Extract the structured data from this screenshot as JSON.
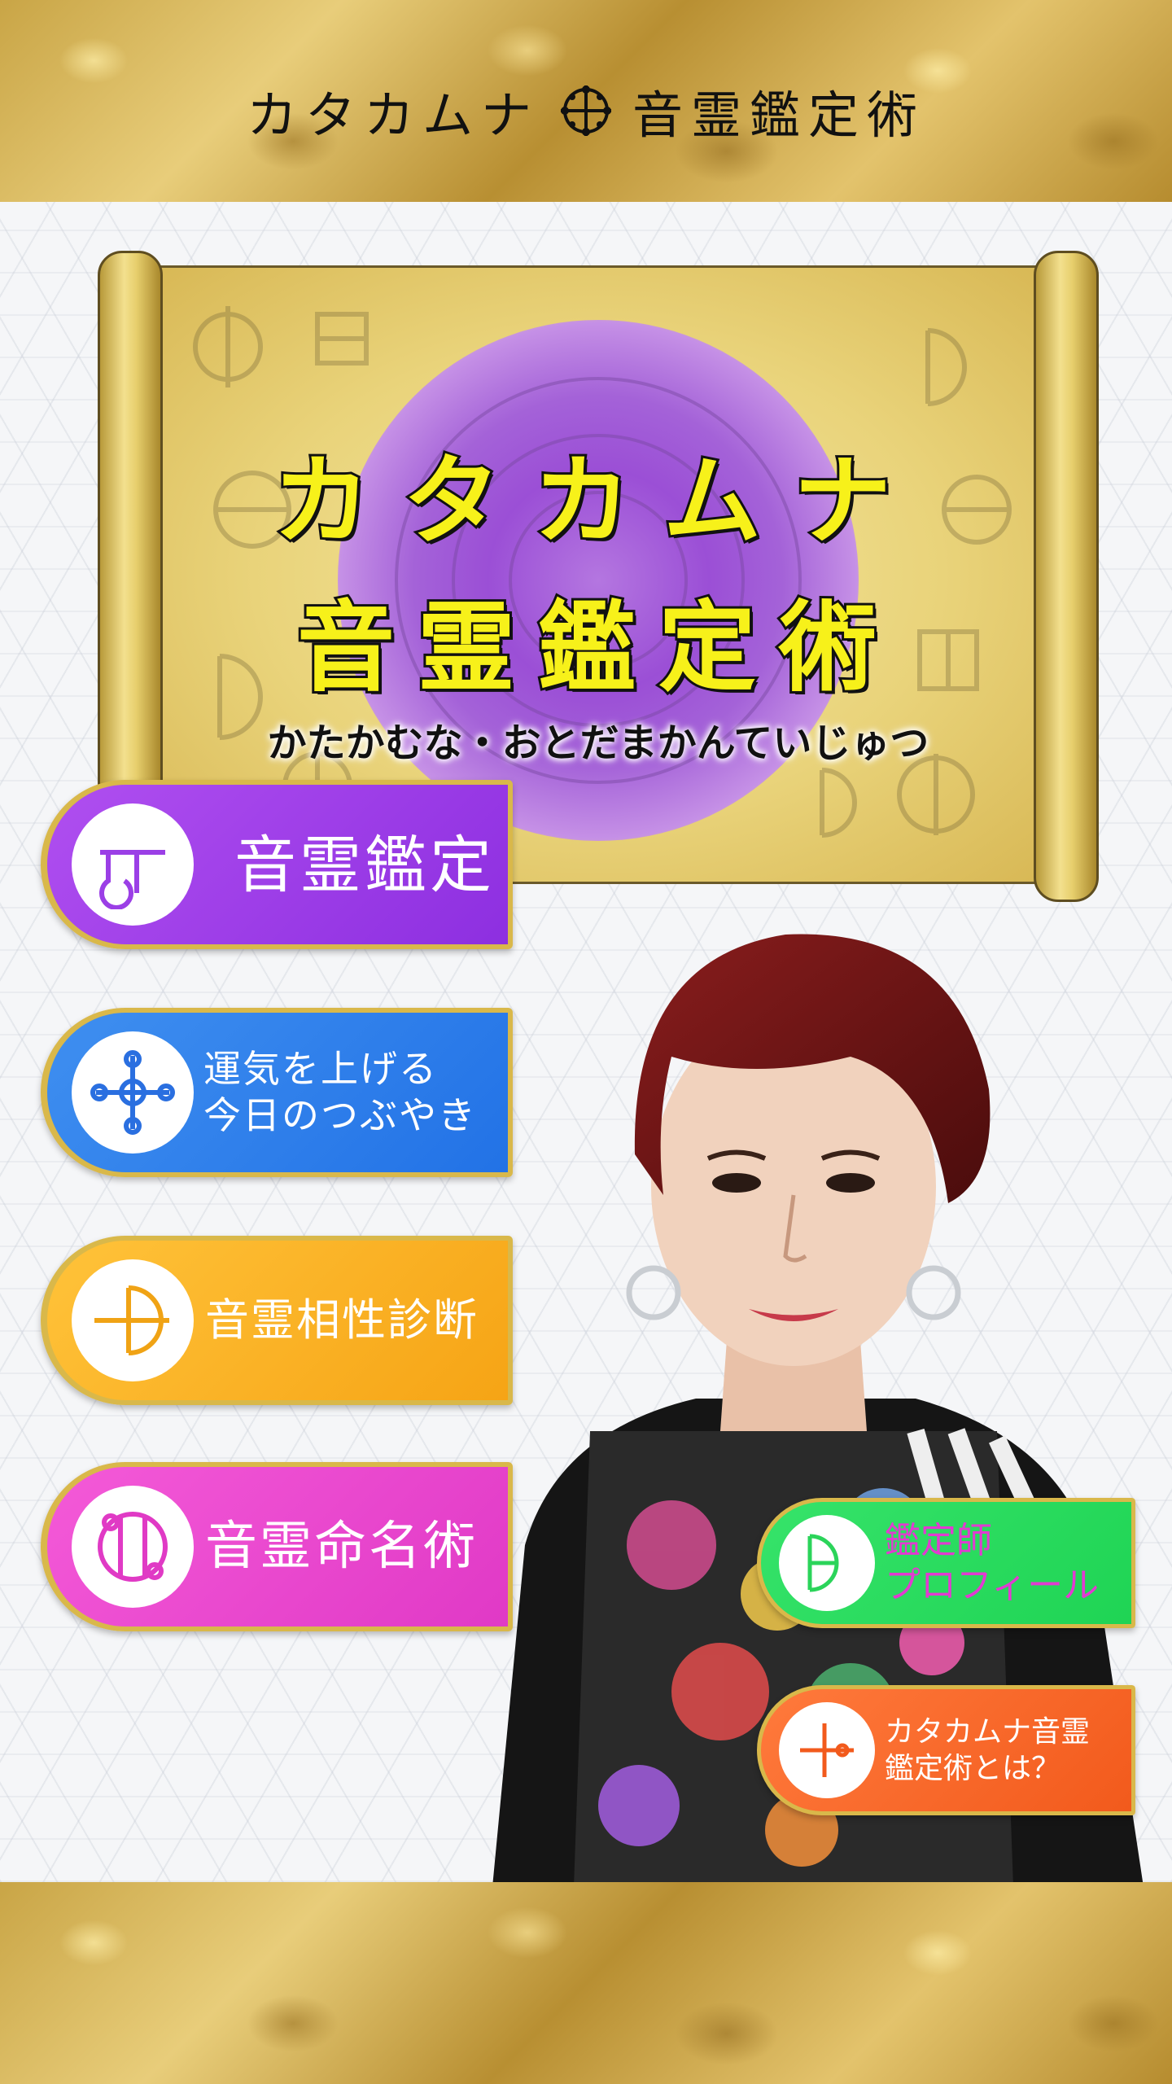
{
  "header": {
    "title_left": "カタカムナ",
    "title_right": "音霊鑑定術"
  },
  "scroll": {
    "title_line1": "カタカムナ",
    "title_line2": "音霊鑑定術",
    "subtitle": "かたかむな・おとだまかんていじゅつ"
  },
  "menu": {
    "b1": {
      "label": "音霊鑑定",
      "icon": "katakamuna-glyph-icon"
    },
    "b2": {
      "line1": "運気を上げる",
      "line2": "今日のつぶやき",
      "icon": "katakamuna-cross-icon"
    },
    "b3": {
      "label": "音霊相性診断",
      "icon": "katakamuna-bow-icon"
    },
    "b4": {
      "label": "音霊命名術",
      "icon": "katakamuna-circle-icon"
    },
    "b5": {
      "line1": "鑑定師",
      "line2": "プロフィール",
      "icon": "katakamuna-d-icon"
    },
    "b6": {
      "line1": "カタカムナ音霊",
      "line2": "鑑定術とは？",
      "icon": "katakamuna-plus-icon"
    }
  },
  "colors": {
    "gold": "#d9b84a",
    "purple": "#9b3fe6",
    "blue": "#2a7be8",
    "yellow": "#f8b322",
    "magenta": "#e643cc",
    "green": "#2bdc5e",
    "orange": "#f66a28",
    "title_yellow": "#f7f11a"
  }
}
